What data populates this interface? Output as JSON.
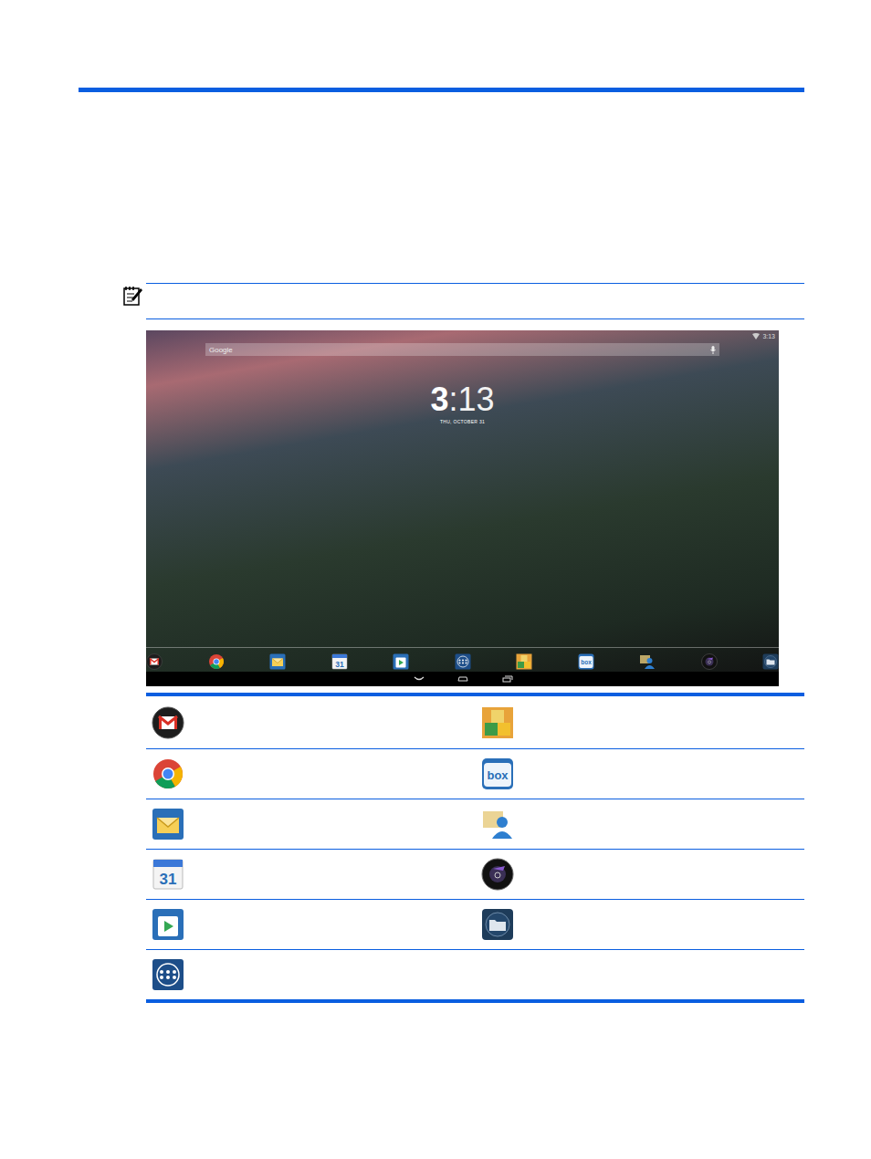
{
  "screenshot": {
    "status_time": "3:13",
    "search_placeholder": "Google",
    "clock_hour": "3",
    "clock_minutes": ":13",
    "clock_date": "THU, OCTOBER 31",
    "dock": [
      {
        "kind": "gmail",
        "label": ""
      },
      {
        "kind": "chrome",
        "label": ""
      },
      {
        "kind": "email",
        "label": ""
      },
      {
        "kind": "calendar",
        "label": "31"
      },
      {
        "kind": "play",
        "label": ""
      },
      {
        "kind": "apps",
        "label": ""
      },
      {
        "kind": "kingsoft",
        "label": ""
      },
      {
        "kind": "box",
        "label": "box"
      },
      {
        "kind": "people",
        "label": ""
      },
      {
        "kind": "media",
        "label": ""
      },
      {
        "kind": "files",
        "label": ""
      }
    ],
    "nav": [
      {
        "kind": "back"
      },
      {
        "kind": "home"
      },
      {
        "kind": "recent"
      }
    ]
  },
  "table": {
    "rows": [
      {
        "left": {
          "kind": "gmail",
          "label": ""
        },
        "right": {
          "kind": "kingsoft",
          "label": ""
        }
      },
      {
        "left": {
          "kind": "chrome",
          "label": ""
        },
        "right": {
          "kind": "box",
          "label": "box"
        }
      },
      {
        "left": {
          "kind": "email",
          "label": ""
        },
        "right": {
          "kind": "people",
          "label": ""
        }
      },
      {
        "left": {
          "kind": "calendar",
          "label": "31"
        },
        "right": {
          "kind": "media",
          "label": ""
        }
      },
      {
        "left": {
          "kind": "play",
          "label": ""
        },
        "right": {
          "kind": "files",
          "label": ""
        }
      },
      {
        "left": {
          "kind": "apps",
          "label": ""
        },
        "right": null
      }
    ]
  }
}
